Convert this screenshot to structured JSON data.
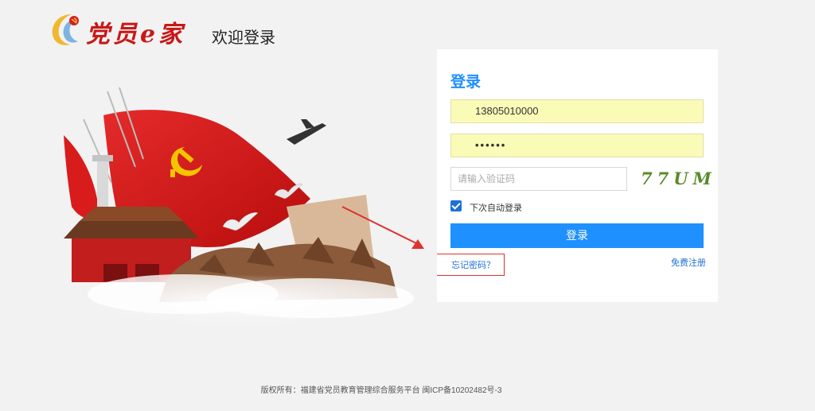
{
  "header": {
    "logo_text": "党员e家",
    "title": "欢迎登录"
  },
  "login": {
    "title": "登录",
    "username_value": "13805010000",
    "password_masked": "••••••",
    "captcha_placeholder": "请输入验证码",
    "captcha_text": "77UM",
    "remember_label": "下次自动登录",
    "remember_checked": true,
    "submit_label": "登录",
    "forgot_label": "忘记密码？",
    "register_label": "免费注册"
  },
  "footer": {
    "copyright": "版权所有：福建省党员教育管理综合服务平台  闽ICP备10202482号-3"
  },
  "colors": {
    "accent": "#1e90ff",
    "annotation": "#e03030",
    "autofill": "#fbfbb8",
    "brand_red": "#c81818"
  }
}
